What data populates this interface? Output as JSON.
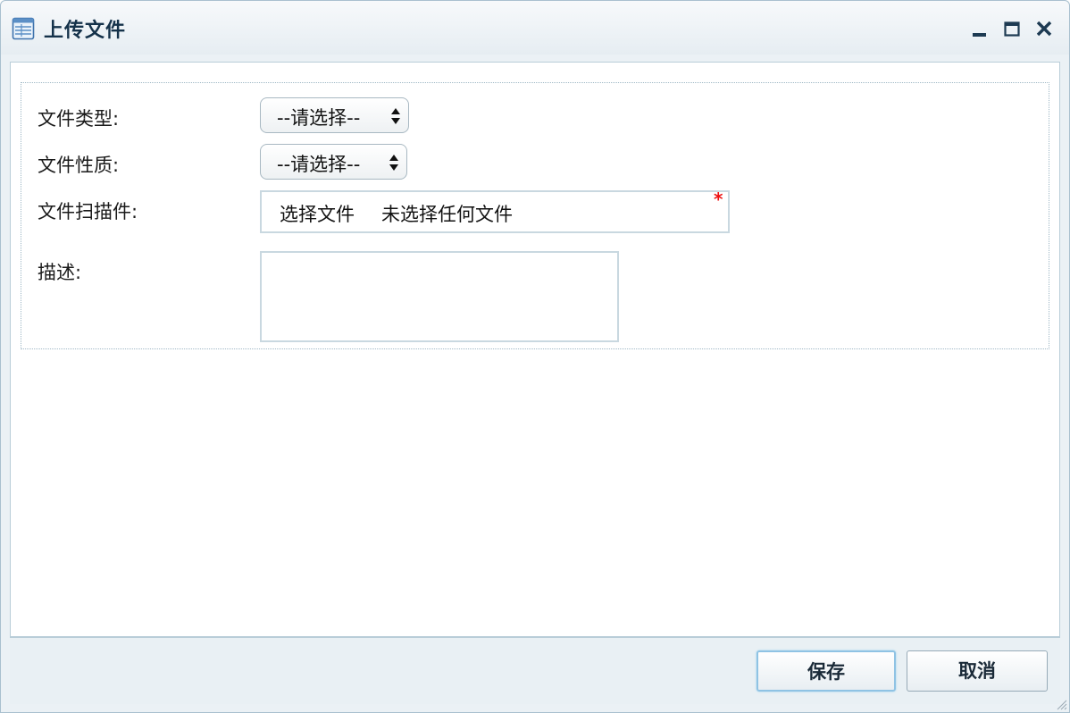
{
  "window": {
    "title": "上传文件",
    "icon": "table-icon",
    "controls": [
      "minimize-icon",
      "maximize-icon",
      "close-icon"
    ]
  },
  "form": {
    "file_type": {
      "label": "文件类型:",
      "selected": "--请选择--"
    },
    "file_nature": {
      "label": "文件性质:",
      "selected": "--请选择--"
    },
    "file_scan": {
      "label": "文件扫描件:",
      "button_label": "选择文件",
      "status": "未选择任何文件",
      "required_mark": "*"
    },
    "description": {
      "label": "描述:",
      "value": ""
    }
  },
  "footer": {
    "save_label": "保存",
    "cancel_label": "取消"
  },
  "colors": {
    "title_text": "#15324a",
    "required": "#e11111",
    "panel_border": "#b9cdd8",
    "footer_bg": "#e9f0f4"
  }
}
